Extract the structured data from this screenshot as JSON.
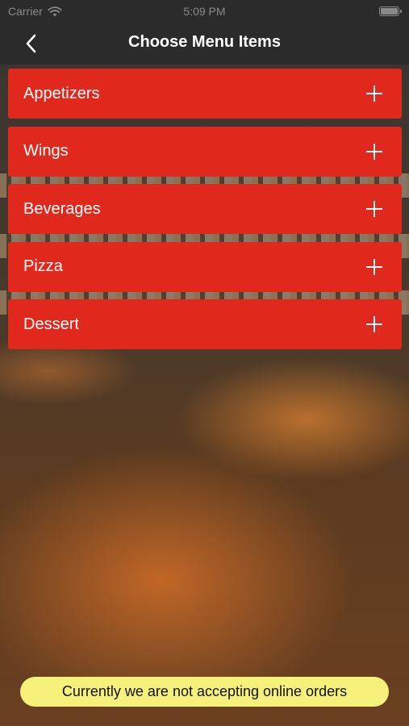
{
  "status": {
    "carrier": "Carrier",
    "time": "5:09 PM"
  },
  "nav": {
    "title": "Choose Menu Items"
  },
  "menu": {
    "items": [
      {
        "label": "Appetizers"
      },
      {
        "label": "Wings"
      },
      {
        "label": "Beverages"
      },
      {
        "label": "Pizza"
      },
      {
        "label": "Dessert"
      }
    ]
  },
  "notice": {
    "text": "Currently we are not accepting online orders"
  },
  "icons": {
    "back": "chevron-left-icon",
    "expand": "plus-icon",
    "wifi": "wifi-icon",
    "battery": "battery-icon"
  },
  "colors": {
    "accent": "#e0281c",
    "notice_bg": "#f5f17a",
    "bar_bg": "#2b2b2b"
  }
}
